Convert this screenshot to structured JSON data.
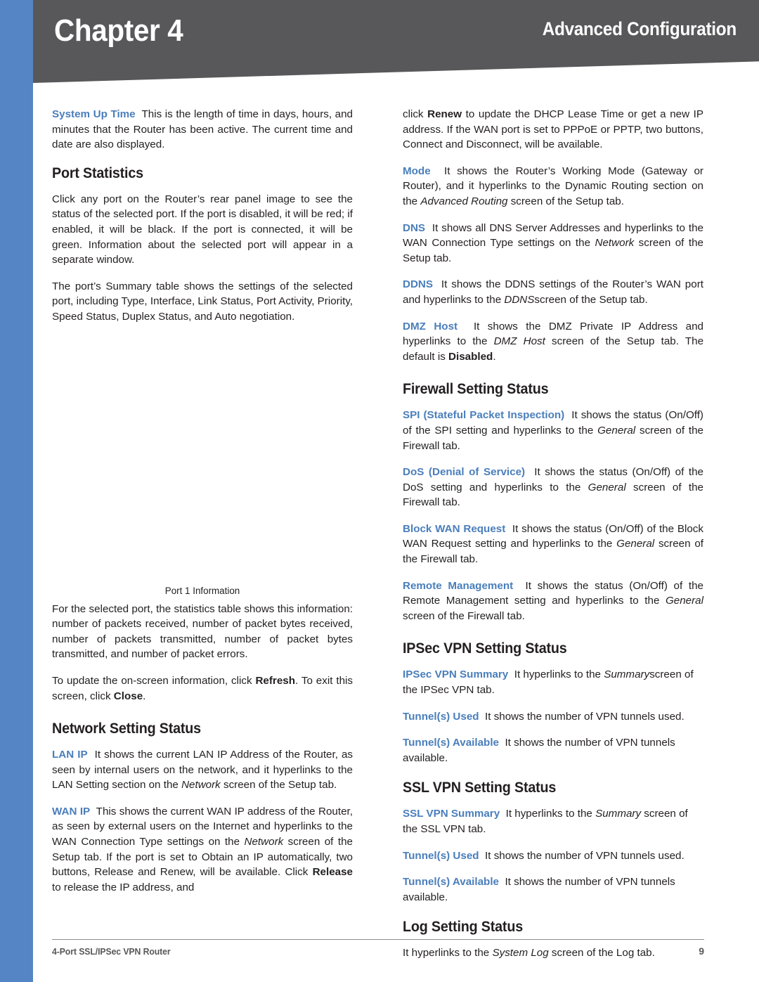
{
  "header": {
    "chapter_label": "Chapter 4",
    "subject": "Advanced Configuration",
    "band_color": "#58585a",
    "spine_color": "#5585c5"
  },
  "accent_color": "#4a7ebb",
  "left_column": {
    "system_up_time": {
      "term": "System Up Time",
      "text": "This is the length of time in days, hours, and minutes that the Router has been active. The current time and date are also displayed."
    },
    "port_statistics_heading": "Port Statistics",
    "port_statistics_p1": "Click any port on the Router’s rear panel image to see the status of the selected port. If the port is disabled, it will be red; if enabled, it will be black. If the port is connected, it will be green. Information about the selected port will appear in a separate window.",
    "port_statistics_p2": "The port’s Summary table shows the settings of the selected port, including Type, Interface, Link Status, Port Activity, Priority, Speed Status, Duplex Status, and Auto negotiation.",
    "figure_caption": "Port 1 Information",
    "stats_p1": "For the selected port, the statistics table shows this information: number of packets received, number of packet bytes received, number of packets transmitted, number of packet bytes transmitted, and number of packet errors.",
    "refresh_p": {
      "pre": "To update the on-screen information, click ",
      "bold1": "Refresh",
      "mid": ". To exit this screen, click ",
      "bold2": "Close",
      "post": "."
    },
    "network_setting_heading": "Network Setting Status",
    "lan_ip": {
      "term": "LAN IP",
      "pre": "It shows the current LAN IP Address of the Router, as seen by internal users on the network, and it hyperlinks to the LAN Setting section on the ",
      "italic": "Network",
      "post": " screen of the Setup tab."
    },
    "wan_ip": {
      "term": "WAN IP",
      "pre": "This shows the current WAN IP address of the Router, as seen by external users on the Internet and hyperlinks to the WAN Connection Type settings on the ",
      "italic": "Network",
      "mid": " screen of the Setup tab. If the port is set to Obtain an IP automatically, two buttons, Release and Renew, will be available. Click ",
      "bold": "Release",
      "post": " to release the IP address, and"
    }
  },
  "right_column": {
    "renew_p": {
      "pre": "click ",
      "bold": "Renew",
      "post": " to update the DHCP Lease Time or get a new IP address. If the WAN port is set to PPPoE or PPTP, two buttons, Connect and Disconnect, will be available."
    },
    "mode": {
      "term": "Mode",
      "pre": "It shows the Router’s Working Mode (Gateway or Router), and it hyperlinks to the Dynamic Routing section on the ",
      "italic": "Advanced Routing",
      "post": " screen of the Setup tab."
    },
    "dns": {
      "term": "DNS",
      "pre": "It shows all DNS Server Addresses and hyperlinks to the WAN Connection Type settings on the ",
      "italic": "Network",
      "post": " screen of the Setup tab."
    },
    "ddns": {
      "term": "DDNS",
      "pre": "It shows the DDNS settings of the Router’s WAN port and hyperlinks to the ",
      "italic": "DDNS",
      "post": "screen of the Setup tab."
    },
    "dmz_host": {
      "term": "DMZ Host",
      "pre": "It shows the DMZ Private IP Address and hyperlinks to the ",
      "italic": "DMZ Host",
      "mid": " screen of the Setup tab. The default is ",
      "bold": "Disabled",
      "post": "."
    },
    "firewall_heading": "Firewall Setting Status",
    "spi": {
      "term": "SPI (Stateful Packet Inspection)",
      "pre": "It shows the status (On/Off) of the SPI setting and hyperlinks to the ",
      "italic": "General",
      "post": " screen of the Firewall tab."
    },
    "dos": {
      "term": "DoS (Denial of Service)",
      "pre": "It shows the status (On/Off) of the DoS setting and hyperlinks to the ",
      "italic": "General",
      "post": " screen of the Firewall tab."
    },
    "block_wan": {
      "term": "Block WAN Request",
      "pre": "It shows the status (On/Off) of the Block WAN Request setting and hyperlinks to the ",
      "italic": "General",
      "post": " screen of the Firewall tab."
    },
    "remote_mgmt": {
      "term": "Remote Management",
      "pre": "It shows the status (On/Off) of the Remote Management setting and hyperlinks to the ",
      "italic": "General",
      "post": " screen of the Firewall tab."
    },
    "ipsec_heading": "IPSec VPN Setting Status",
    "ipsec_summary": {
      "term": "IPSec VPN Summary",
      "pre": "It hyperlinks to the ",
      "italic": "Summary",
      "post": "screen of the IPSec VPN tab."
    },
    "ipsec_tunnels_used": {
      "term": "Tunnel(s) Used",
      "text": "It shows the number of VPN tunnels used."
    },
    "ipsec_tunnels_available": {
      "term": "Tunnel(s) Available",
      "text": "It shows the number of VPN tunnels available."
    },
    "ssl_heading": "SSL VPN Setting Status",
    "ssl_summary": {
      "term": "SSL VPN Summary",
      "pre": "It hyperlinks to the ",
      "italic": "Summary",
      "post": " screen of the SSL VPN tab."
    },
    "ssl_tunnels_used": {
      "term": "Tunnel(s) Used",
      "text": "It shows the number of VPN tunnels used."
    },
    "ssl_tunnels_available": {
      "term": "Tunnel(s) Available",
      "text": "It shows the number of VPN tunnels available."
    },
    "log_heading": "Log Setting Status",
    "log_p": {
      "pre": "It hyperlinks to the ",
      "italic": "System Log",
      "post": " screen of the Log tab."
    }
  },
  "footer": {
    "product": "4-Port SSL/IPSec VPN Router",
    "page_number": "9"
  }
}
